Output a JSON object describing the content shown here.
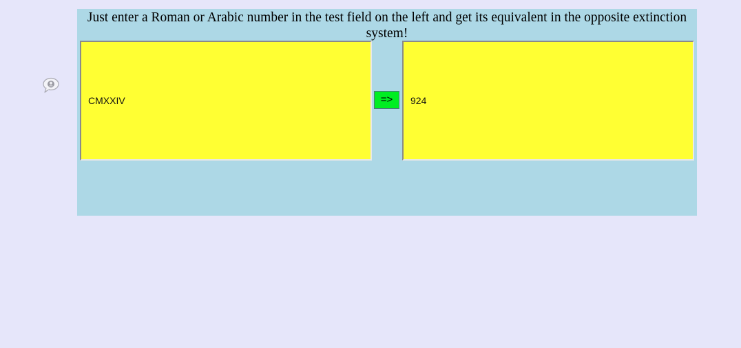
{
  "instructions": "Just enter a Roman or Arabic number in the test field on the left and get its equivalent in the opposite extinction system!",
  "input": {
    "value": "CMXXIV"
  },
  "convert_button": {
    "label": "=>"
  },
  "output": {
    "value": "924"
  },
  "icons": {
    "chat": "speech-bubble-icon"
  },
  "colors": {
    "page_background": "#e6e6fa",
    "panel_background": "#add8e6",
    "field_background": "#ffff33",
    "button_background": "#00ee22"
  }
}
